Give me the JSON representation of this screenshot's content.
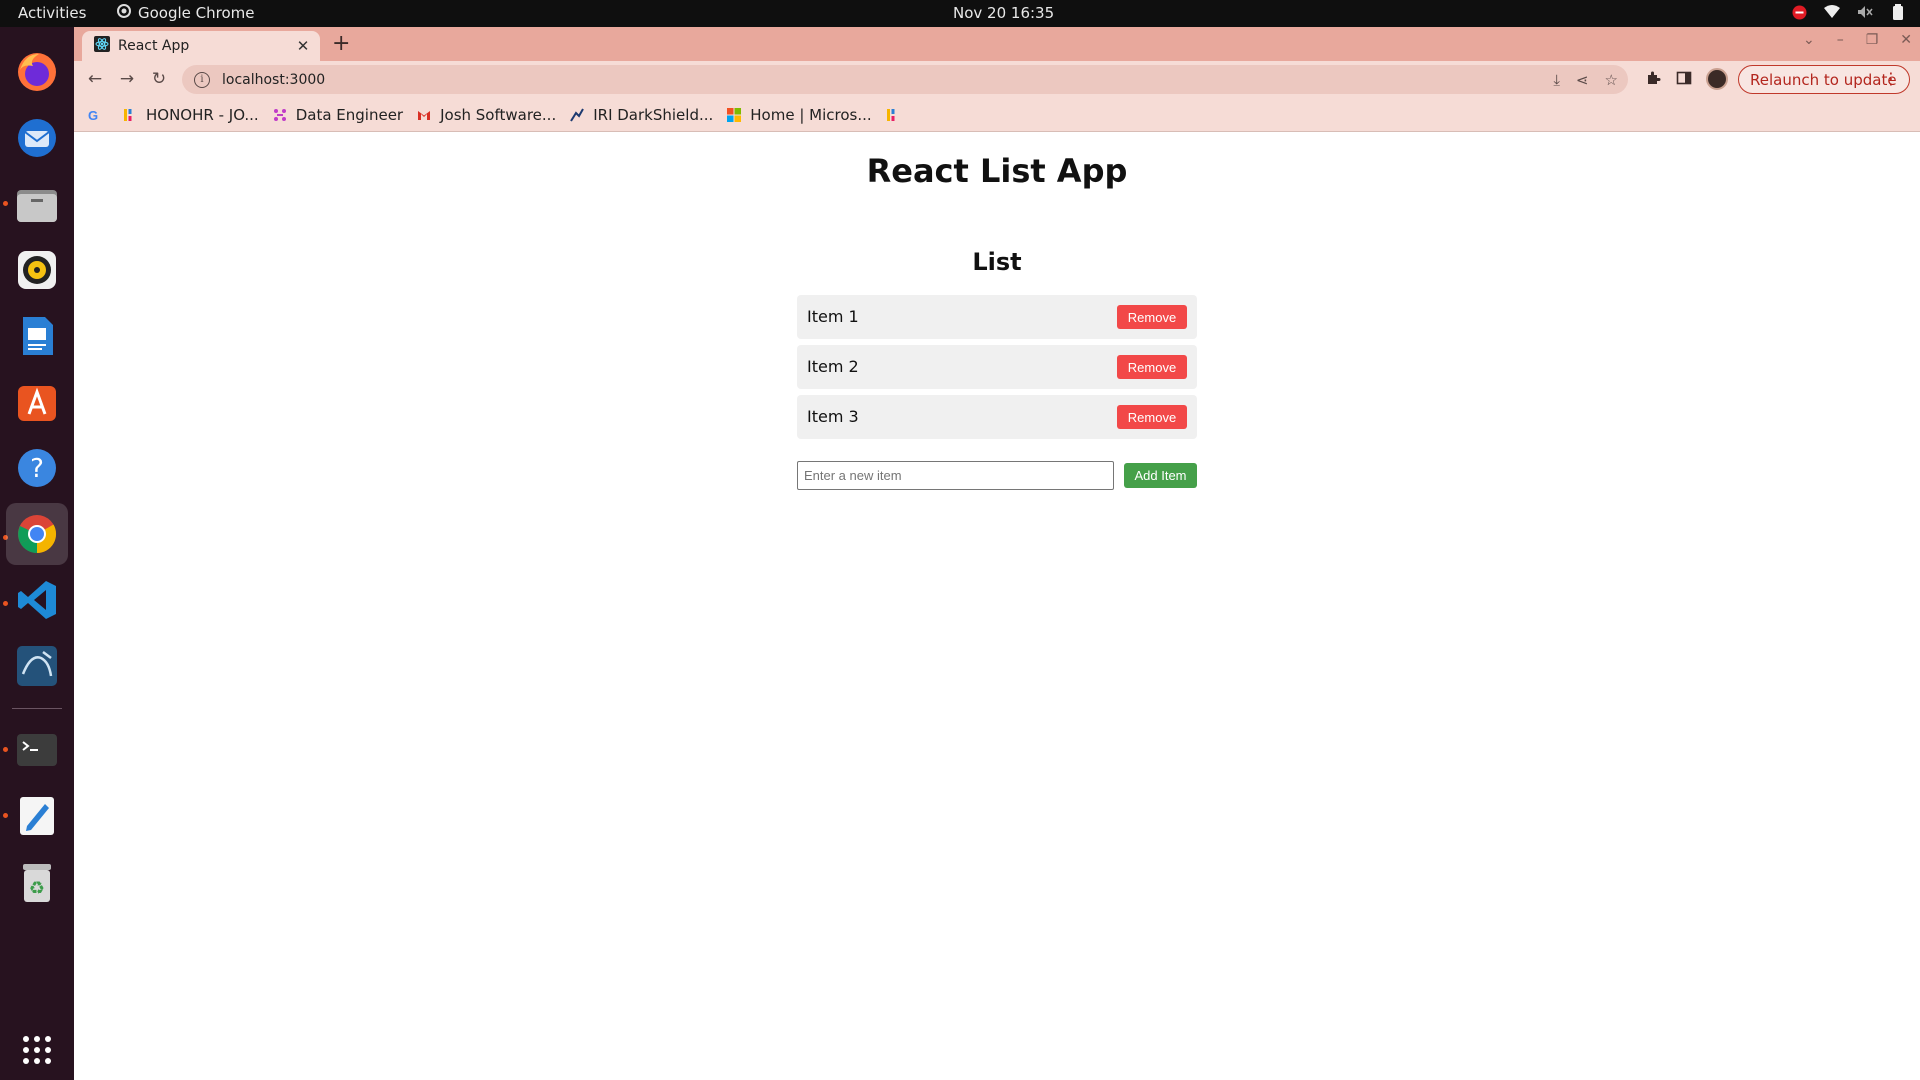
{
  "system": {
    "activities_label": "Activities",
    "focused_app": "Google Chrome",
    "clock": "Nov 20  16:35"
  },
  "dock": {
    "items": [
      "firefox",
      "thunderbird",
      "files",
      "rhythmbox",
      "libreoffice-writer",
      "ubuntu-software",
      "help",
      "google-chrome",
      "visual-studio-code",
      "mysql-workbench",
      "terminal",
      "text-editor",
      "trash"
    ],
    "active": "google-chrome",
    "show_apps": "show-applications"
  },
  "browser": {
    "tab_title": "React App",
    "url": "localhost:3000",
    "relaunch_label": "Relaunch to update",
    "bookmarks": [
      {
        "label": "HONOHR - JO...",
        "icon": "honohr-favicon"
      },
      {
        "label": "Data Engineer",
        "icon": "data-engineer-favicon"
      },
      {
        "label": "Josh Software...",
        "icon": "gmail-favicon"
      },
      {
        "label": "IRI DarkShield...",
        "icon": "iri-favicon"
      },
      {
        "label": "Home | Micros...",
        "icon": "microsoft-favicon"
      }
    ],
    "accent": "#e8a89c"
  },
  "page": {
    "title": "React List App",
    "list_heading": "List",
    "items": [
      {
        "label": "Item 1",
        "button": "Remove"
      },
      {
        "label": "Item 2",
        "button": "Remove"
      },
      {
        "label": "Item 3",
        "button": "Remove"
      }
    ],
    "input_placeholder": "Enter a new item",
    "input_value": "",
    "add_button": "Add Item",
    "colors": {
      "remove": "#f24848",
      "add": "#45a049"
    }
  }
}
